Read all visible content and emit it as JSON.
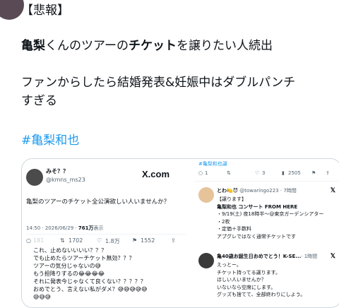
{
  "post": {
    "line1": "【悲報】",
    "line2_a": "亀梨",
    "line2_b": "くんのツアーの",
    "line2_c": "チケット",
    "line2_d": "を譲りたい人続出",
    "line3": "ファンからしたら結婚発表&妊娠中はダブルパンチ",
    "line4": "すぎる",
    "hashtag": "#亀梨和也"
  },
  "embed_left": {
    "name": "みそ？？",
    "handle": "@kmns_ms23",
    "logo": "X.com",
    "text": "亀梨のツアーのチケット全公演欲しい人いませんか？",
    "meta_time": "14:50 · 2026/06/29 · ",
    "meta_views": "761万",
    "meta_views_label": "表示",
    "actions": {
      "reply": "181",
      "retweet": "1702",
      "like": "1.8万",
      "bookmark": "1552"
    },
    "reply_lines": [
      "これ、止めないいいい？？？",
      "でも止めたらツアーチケット無効？？？",
      "ツアーの気分じゃないの😅",
      "もう担降りするの😂😂😂😂",
      "それに発表今じゃなくて良くない？？？？？",
      "おめでとう、言えない私がダメ？😅😅😅😅😅",
      "😅😅😅"
    ]
  },
  "embed_right": {
    "tag": "#亀梨和也譲",
    "actions": {
      "reply": "1",
      "retweet": "",
      "like": "3",
      "views": "2505"
    },
    "post1": {
      "name": "とわ🍋😈",
      "handle": "@towaringo223 · 7時間",
      "lines": [
        "【譲ります】",
        "亀梨和也 コンサート FROM HERE",
        "・9/19(土) 夜18時半〜@東京ガーデンシアター",
        "・2枚",
        "・定価＋手数料",
        "アプグレではなく通常チケットです"
      ]
    },
    "post2": {
      "name": "亀40歳お誕生日おめでとう！K-SE...",
      "handle": "· 1時間",
      "lines": [
        "えっとー。",
        "チケット持ってる譲ります。",
        "ほしい人いませんか？",
        "いないなら空席にします。",
        "グッズも捨てて、全部終わりにしよう。"
      ]
    }
  }
}
